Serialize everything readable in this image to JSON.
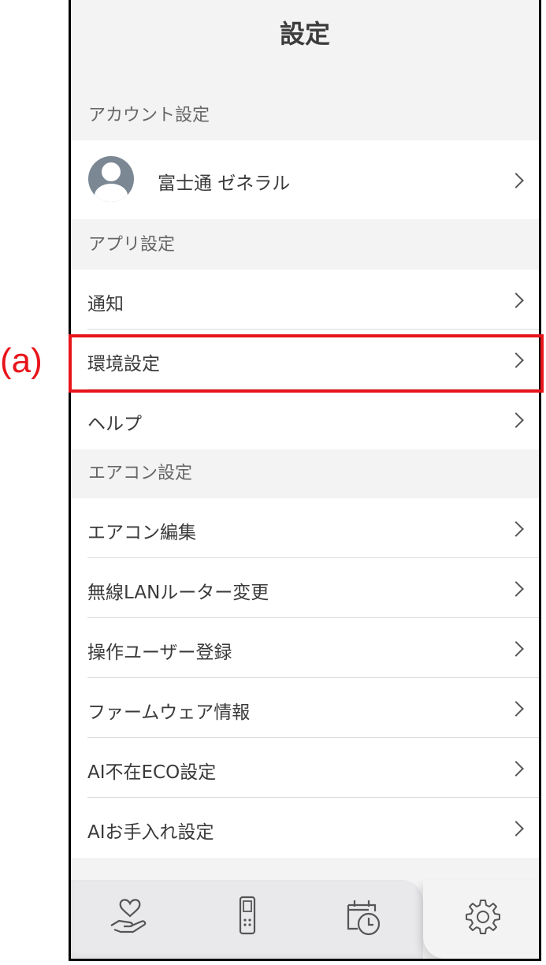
{
  "annotation": {
    "label": "(a)",
    "color": "#e8141b"
  },
  "header": {
    "title": "設定"
  },
  "sections": {
    "account": "アカウント設定",
    "app": "アプリ設定",
    "aircon": "エアコン設定"
  },
  "account": {
    "name": "富士通 ゼネラル"
  },
  "app_items": [
    "通知",
    "環境設定",
    "ヘルプ"
  ],
  "aircon_items": [
    "エアコン編集",
    "無線LANルーター変更",
    "操作ユーザー登録",
    "ファームウェア情報",
    "AI不在ECO設定",
    "AIお手入れ設定"
  ],
  "tabs": [
    {
      "icon": "hand-heart-icon"
    },
    {
      "icon": "remote-control-icon"
    },
    {
      "icon": "calendar-clock-icon"
    },
    {
      "icon": "gear-icon",
      "active": true
    }
  ]
}
